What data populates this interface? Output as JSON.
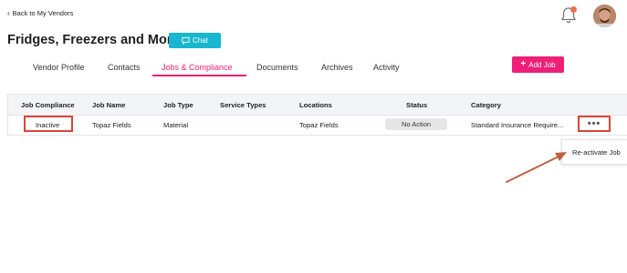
{
  "nav": {
    "back_label": "Back to My Vendors"
  },
  "header": {
    "title": "Fridges, Freezers and More",
    "chat_label": "Chat",
    "notification_color": "#e8734a"
  },
  "tabs": [
    {
      "label": "Vendor Profile"
    },
    {
      "label": "Contacts"
    },
    {
      "label": "Jobs & Compliance",
      "active": true
    },
    {
      "label": "Documents"
    },
    {
      "label": "Archives"
    },
    {
      "label": "Activity"
    }
  ],
  "actions": {
    "add_job_label": "Add Job"
  },
  "table": {
    "columns": [
      "Job Compliance",
      "Job Name",
      "Job Type",
      "Service Types",
      "Locations",
      "Status",
      "Category"
    ],
    "rows": [
      {
        "job_compliance": "Inactive",
        "job_name": "Topaz Fields",
        "job_type": "Material",
        "service_types": "",
        "locations": "Topaz Fields",
        "status": "No Action",
        "category": "Standard Insurance Require..."
      }
    ]
  },
  "row_menu": {
    "trigger": "•••",
    "items": [
      {
        "label": "Re-activate Job"
      }
    ]
  },
  "colors": {
    "accent_pink": "#ee1f77",
    "chat_teal": "#19b7cf",
    "highlight_red": "#d9453a",
    "arrow": "#c0603f"
  }
}
